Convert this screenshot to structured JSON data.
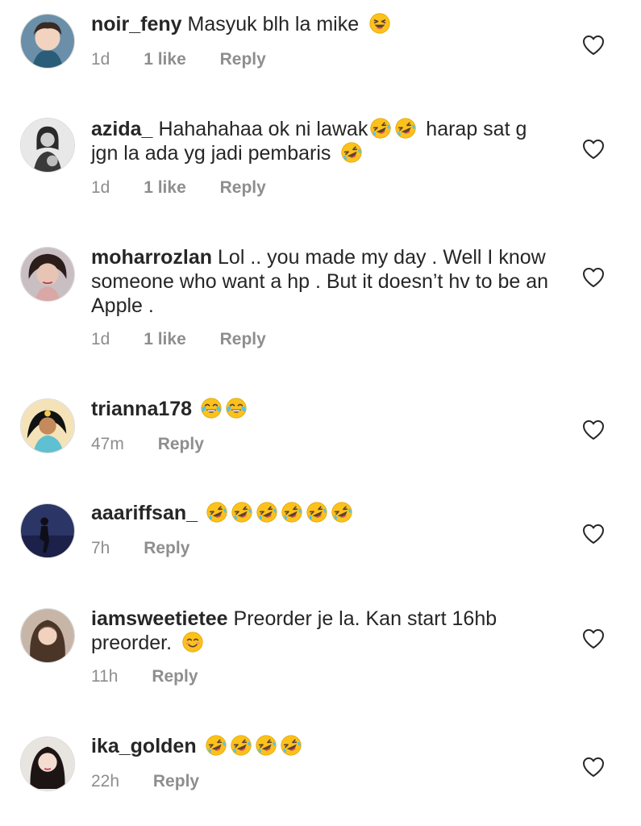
{
  "comments": [
    {
      "username": "noir_feny",
      "text": "Masyuk blh la mike",
      "emojis_after_text": [
        "laughing-squint"
      ],
      "time": "1d",
      "likes": "1 like",
      "reply": "Reply"
    },
    {
      "username": "azida_",
      "text_part1": "Hahahahaa ok ni lawak",
      "emojis_mid": [
        "rolling-laughing",
        "rolling-laughing"
      ],
      "text_part2": "harap sat g jgn la ada yg jadi pembaris",
      "emojis_after_text": [
        "rolling-laughing"
      ],
      "time": "1d",
      "likes": "1 like",
      "reply": "Reply"
    },
    {
      "username": "moharrozlan",
      "text": "Lol .. you made my day .  Well I know someone who want a hp . But it doesn’t hv to be an Apple .",
      "time": "1d",
      "likes": "1 like",
      "reply": "Reply"
    },
    {
      "username": "trianna178",
      "emojis_after_text": [
        "joy",
        "joy"
      ],
      "time": "47m",
      "reply": "Reply"
    },
    {
      "username": "aaariffsan_",
      "emojis_after_text": [
        "rolling-laughing",
        "rolling-laughing",
        "rolling-laughing",
        "rolling-laughing",
        "rolling-laughing",
        "rolling-laughing"
      ],
      "time": "7h",
      "reply": "Reply"
    },
    {
      "username": "iamsweetietee",
      "text": "Preorder je la. Kan start 16hb preorder.",
      "emojis_after_text": [
        "smiling-blush"
      ],
      "time": "11h",
      "reply": "Reply"
    },
    {
      "username": "ika_golden",
      "emojis_after_text": [
        "rolling-laughing",
        "rolling-laughing",
        "rolling-laughing",
        "rolling-laughing"
      ],
      "time": "22h",
      "reply": "Reply"
    }
  ],
  "colors": {
    "text": "#262626",
    "meta": "#8e8e8e",
    "emoji_face": "#fcc21b",
    "tear": "#4fc3f7"
  },
  "icons": {
    "like": "heart-outline-icon"
  }
}
